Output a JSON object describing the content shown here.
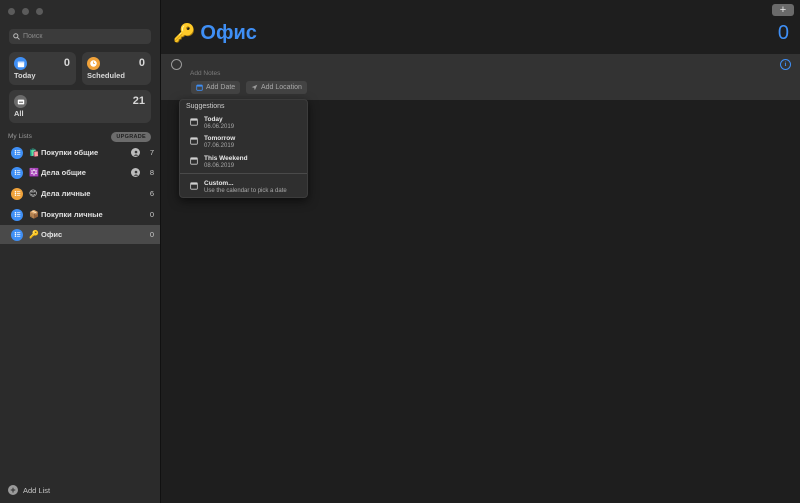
{
  "window": {
    "add_button": "+"
  },
  "search": {
    "placeholder": "Поиск"
  },
  "smart_lists": {
    "today": {
      "label": "Today",
      "count": "0",
      "color": "#3f8ff5"
    },
    "scheduled": {
      "label": "Scheduled",
      "count": "0",
      "color": "#f0a23a"
    },
    "all": {
      "label": "All",
      "count": "21",
      "color": "#6b6b6b"
    }
  },
  "my_lists": {
    "heading": "My Lists",
    "upgrade_label": "UPGRADE",
    "items": [
      {
        "emoji": "🛍️",
        "label": "Покупки общие",
        "count": "7",
        "shared": true,
        "color": "#3f8ff5"
      },
      {
        "emoji": "✡️",
        "label": "Дела общие",
        "count": "8",
        "shared": true,
        "color": "#3f8ff5"
      },
      {
        "emoji": "😊",
        "label": "Дела личные",
        "count": "6",
        "shared": false,
        "color": "#f0a23a"
      },
      {
        "emoji": "📦",
        "label": "Покупки личные",
        "count": "0",
        "shared": false,
        "color": "#3f8ff5"
      },
      {
        "emoji": "🔑",
        "label": "Офис",
        "count": "0",
        "shared": false,
        "color": "#3f8ff5"
      }
    ]
  },
  "add_list": {
    "label": "Add List"
  },
  "main": {
    "title_emoji": "🔑",
    "title": "Офис",
    "count": "0",
    "accent": "#3f8ff5",
    "task": {
      "value": "",
      "notes_placeholder": "Add Notes",
      "add_date_label": "Add Date",
      "add_location_label": "Add Location"
    }
  },
  "suggestions": {
    "heading": "Suggestions",
    "items": [
      {
        "title": "Today",
        "sub": "06.06.2019"
      },
      {
        "title": "Tomorrow",
        "sub": "07.06.2019"
      },
      {
        "title": "This Weekend",
        "sub": "08.06.2019"
      },
      {
        "title": "Custom...",
        "sub": "Use the calendar to pick a date"
      }
    ]
  }
}
